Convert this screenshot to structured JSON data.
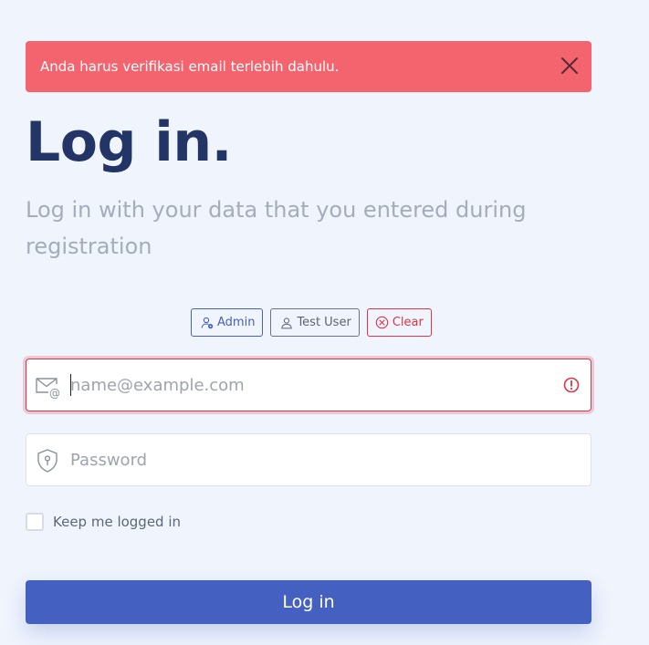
{
  "alert": {
    "message": "Anda harus verifikasi email terlebih dahulu.",
    "close_icon": "close-icon",
    "color": "#f4646e"
  },
  "heading": {
    "title": "Log in.",
    "subtitle": "Log in with your data that you entered during registration"
  },
  "quick_logins": [
    {
      "label": "Admin",
      "icon": "user-gear-icon",
      "color": "#4661be"
    },
    {
      "label": "Test User",
      "icon": "user-icon",
      "color": "#5d6270"
    },
    {
      "label": "Clear",
      "icon": "x-circle-icon",
      "color": "#dc3545"
    }
  ],
  "form": {
    "email": {
      "placeholder": "name@example.com",
      "value": "",
      "icon": "envelope-icon",
      "state": "invalid",
      "status_icon": "exclamation-circle-icon"
    },
    "password": {
      "placeholder": "Password",
      "value": "",
      "icon": "shield-lock-icon"
    },
    "remember": {
      "label": "Keep me logged in",
      "checked": false
    },
    "submit_label": "Log in"
  },
  "colors": {
    "primary": "#4460c1",
    "title": "#233466",
    "danger": "#dc3545",
    "background": "#eff4fd"
  }
}
